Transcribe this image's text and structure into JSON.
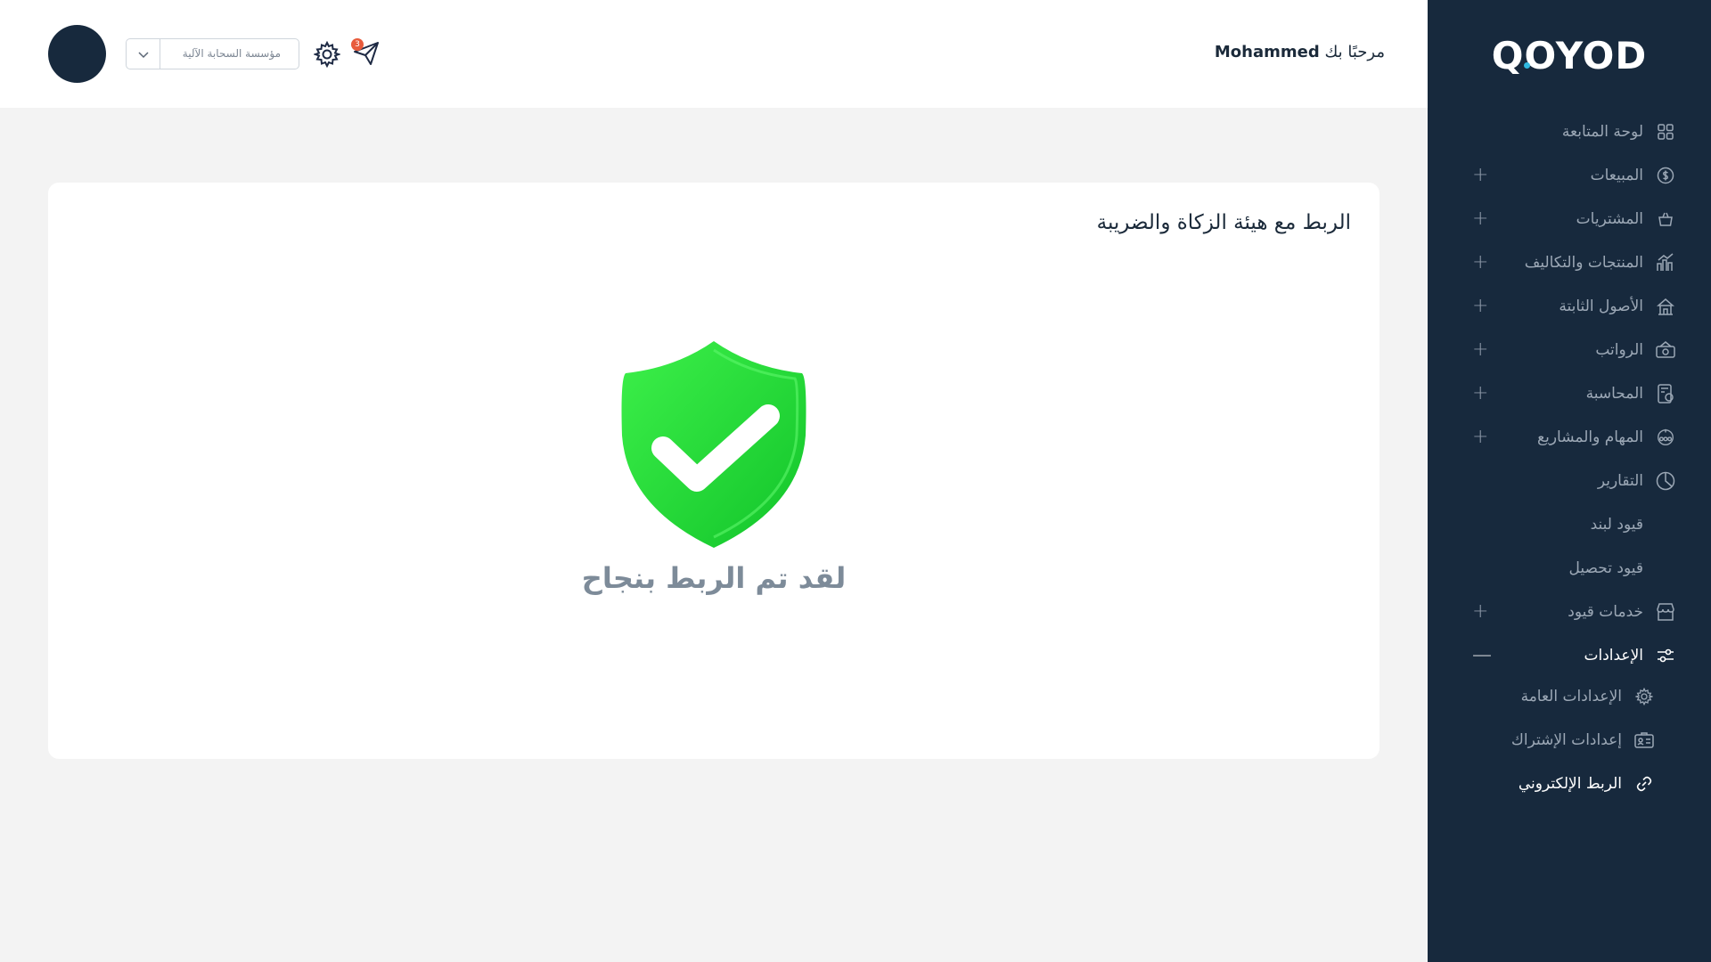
{
  "brand": {
    "logo": "QOYOD"
  },
  "header": {
    "welcome_prefix": "مرحبًا بك",
    "user_name": "Mohammed",
    "organization": "مؤسسة السحابة الآلية",
    "notification_count": "3"
  },
  "sidebar": {
    "items": [
      {
        "label": "لوحة المتابعة",
        "icon": "dashboard-icon",
        "expandable": false
      },
      {
        "label": "المبيعات",
        "icon": "dollar-icon",
        "expandable": true
      },
      {
        "label": "المشتريات",
        "icon": "basket-icon",
        "expandable": true
      },
      {
        "label": "المنتجات والتكاليف",
        "icon": "products-icon",
        "expandable": true
      },
      {
        "label": "الأصول الثابتة",
        "icon": "assets-icon",
        "expandable": true
      },
      {
        "label": "الرواتب",
        "icon": "salary-icon",
        "expandable": true
      },
      {
        "label": "المحاسبة",
        "icon": "accounting-icon",
        "expandable": true
      },
      {
        "label": "المهام والمشاريع",
        "icon": "projects-icon",
        "expandable": true
      },
      {
        "label": "التقارير",
        "icon": "reports-icon",
        "expandable": false
      },
      {
        "label": "قيود لبند",
        "icon": "",
        "expandable": false
      },
      {
        "label": "قيود تحصيل",
        "icon": "",
        "expandable": false
      },
      {
        "label": "خدمات قيود",
        "icon": "store-icon",
        "expandable": true
      },
      {
        "label": "الإعدادات",
        "icon": "sliders-icon",
        "expandable": true,
        "expanded": true
      }
    ],
    "settings_children": [
      {
        "label": "الإعدادات العامة",
        "icon": "gear-icon"
      },
      {
        "label": "إعدادات الإشتراك",
        "icon": "id-card-icon"
      },
      {
        "label": "الربط الإلكتروني",
        "icon": "link-icon"
      }
    ]
  },
  "main": {
    "card_title": "الربط مع هيئة الزكاة والضريبة",
    "success_message": "لقد تم الربط بنجاح"
  },
  "colors": {
    "sidebar_bg": "#17293d",
    "accent_green": "#1ed13a",
    "badge": "#e85b3c"
  }
}
